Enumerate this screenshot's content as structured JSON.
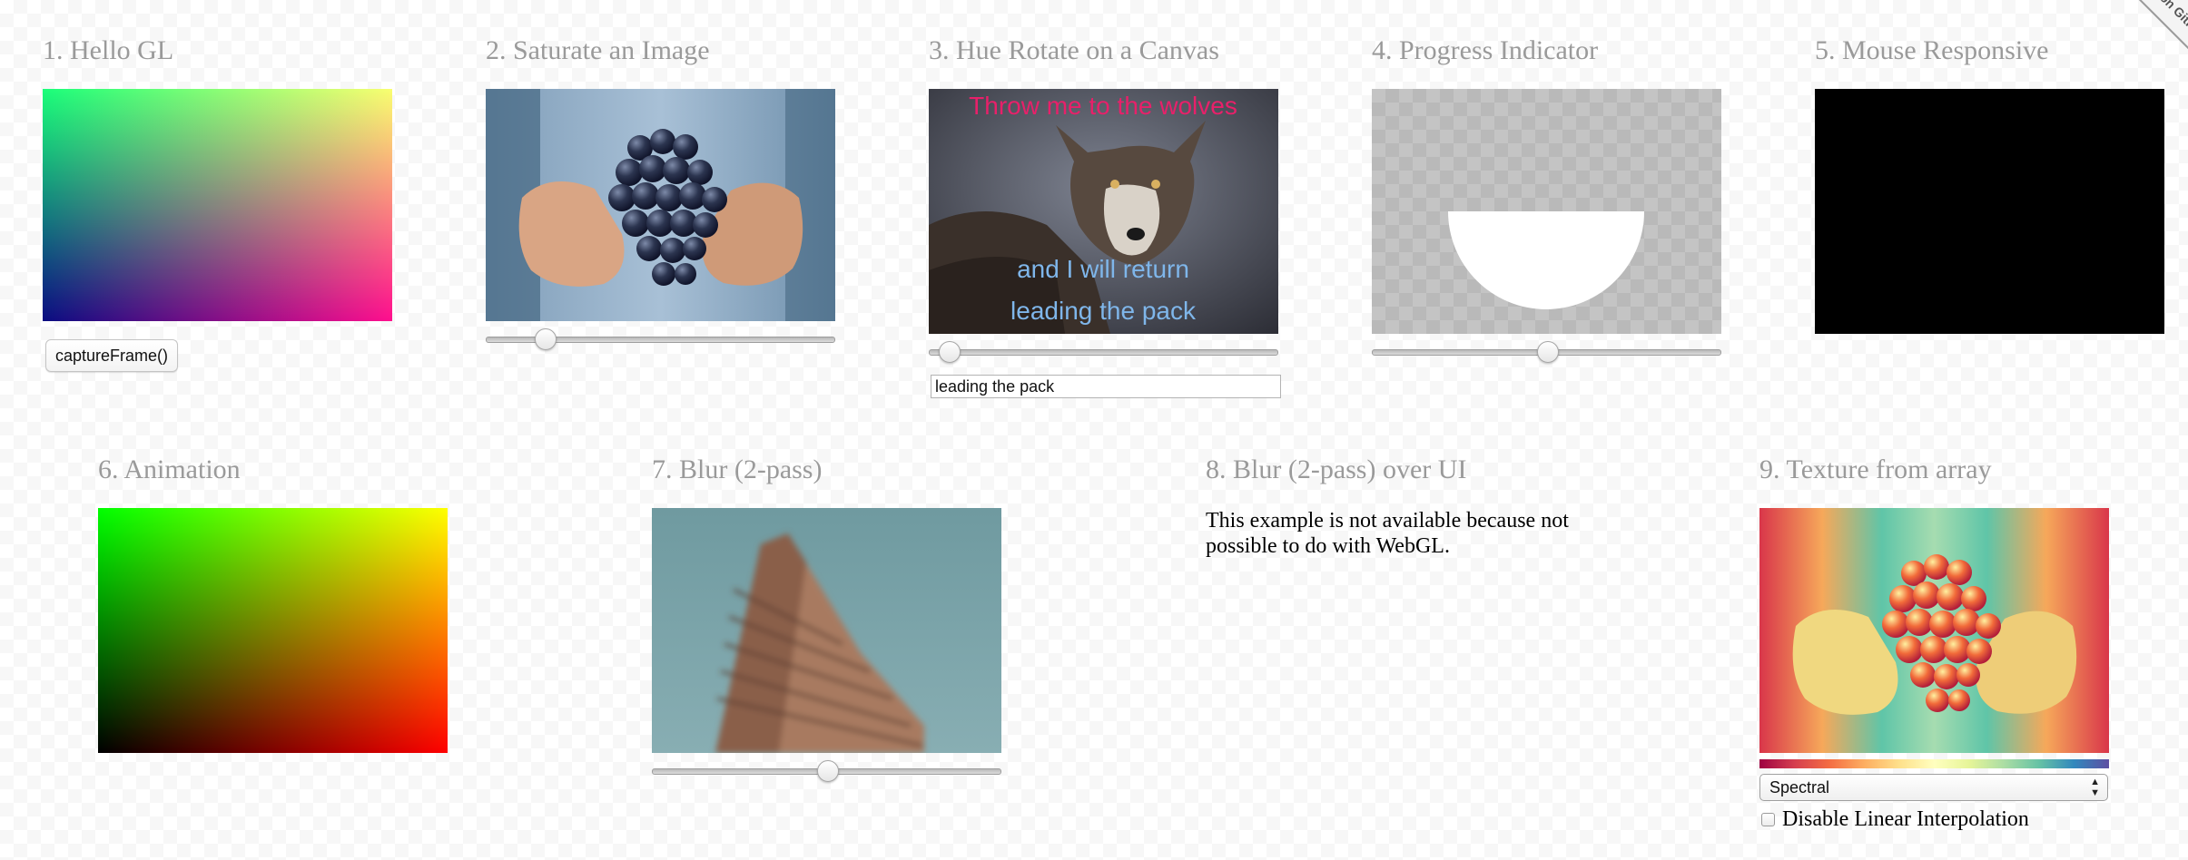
{
  "corner_ribbon": {
    "label": "Fork me on GitHub"
  },
  "examples": [
    {
      "title": "1. Hello GL",
      "button_label": "captureFrame()"
    },
    {
      "title": "2. Saturate an Image",
      "slider_value": 0.15
    },
    {
      "title": "3. Hue Rotate on a Canvas",
      "overlay_text_top": "Throw me to the wolves",
      "overlay_text_line1": "and I will return",
      "overlay_text_line2": "leading the pack",
      "slider_value": 0.03,
      "text_input_value": "leading the pack"
    },
    {
      "title": "4. Progress Indicator",
      "slider_value": 0.5
    },
    {
      "title": "5. Mouse Responsive"
    },
    {
      "title": "6. Animation"
    },
    {
      "title": "7. Blur (2-pass)",
      "slider_value": 0.5
    },
    {
      "title": "8. Blur (2-pass) over UI",
      "message": "This example is not available because not possible to do with WebGL."
    },
    {
      "title": "9. Texture from array",
      "select_value": "Spectral",
      "checkbox_label": "Disable Linear Interpolation",
      "checkbox_checked": false
    }
  ],
  "colors": {
    "title_gray": "#9a9a9a",
    "hue_text_pink": "#e8206a",
    "hue_text_blue": "#7fb6ea"
  }
}
